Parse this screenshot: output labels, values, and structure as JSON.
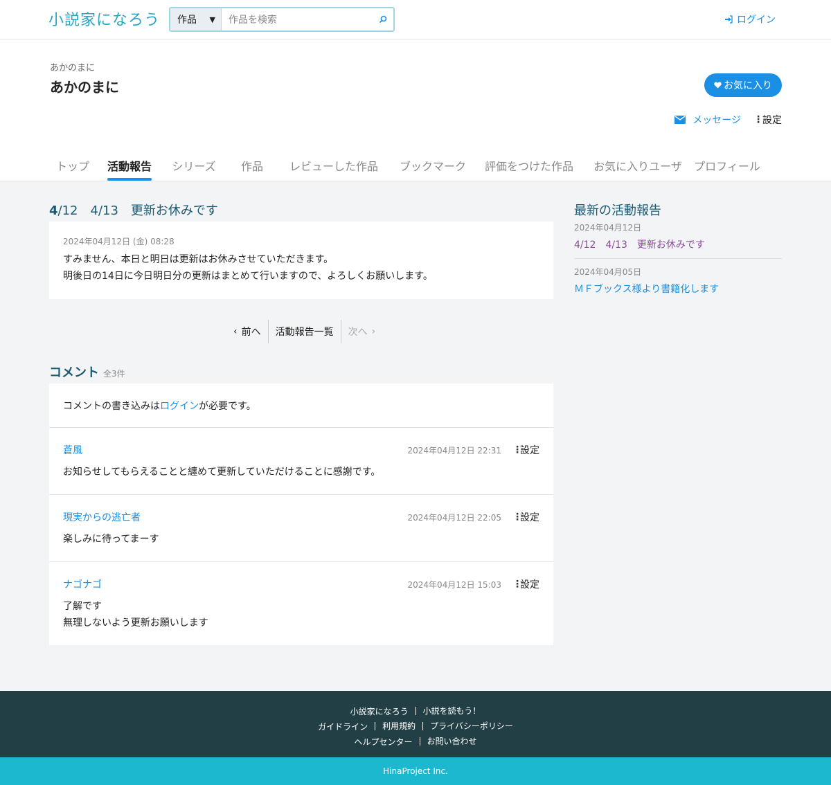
{
  "header": {
    "logo_text": "小説家になろう",
    "search": {
      "category": "作品",
      "placeholder": "作品を検索"
    },
    "login_label": "ログイン"
  },
  "profile": {
    "sub_name": "あかのまに",
    "name": "あかのまに",
    "favorite_label": "お気に入り",
    "message_label": "メッセージ",
    "settings_label": "設定"
  },
  "tabs": [
    "トップ",
    "活動報告",
    "シリーズ",
    "作品",
    "レビューした作品",
    "ブックマーク",
    "評価をつけた作品",
    "お気に入りユーザ",
    "プロフィール"
  ],
  "active_tab": "活動報告",
  "report": {
    "title_bold": "4",
    "title_rest": "/12　4/13　更新お休みです",
    "date": "2024年04月12日 (金) 08:28",
    "lines": [
      "すみません、本日と明日は更新はお休みさせていただきます。",
      "明後日の14日に今日明日分の更新はまとめて行いますので、よろしくお願いします。"
    ]
  },
  "pager": {
    "prev": "前へ",
    "list": "活動報告一覧",
    "next": "次へ"
  },
  "comments": {
    "title": "コメント",
    "count": "全3件",
    "note_before": "コメントの書き込みは",
    "note_link": "ログイン",
    "note_after": "が必要です。",
    "settings_label": "設定",
    "items": [
      {
        "author": "蒼風",
        "date": "2024年04月12日 22:31",
        "lines": [
          "お知らせしてもらえることと纏めて更新していただけることに感謝です。"
        ]
      },
      {
        "author": "現実からの逃亡者",
        "date": "2024年04月12日 22:05",
        "lines": [
          "楽しみに待ってまーす"
        ]
      },
      {
        "author": "ナゴナゴ",
        "date": "2024年04月12日 15:03",
        "lines": [
          "了解です",
          "無理しないよう更新お願いします"
        ]
      }
    ]
  },
  "sidebar": {
    "title": "最新の活動報告",
    "items": [
      {
        "date": "2024年04月12日",
        "title": "4/12　4/13　更新お休みです",
        "visited": true
      },
      {
        "date": "2024年04月05日",
        "title": "ＭＦブックス様より書籍化します",
        "visited": false
      }
    ]
  },
  "footer": {
    "rows": [
      [
        "小説家になろう",
        "小説を読もう！"
      ],
      [
        "ガイドライン",
        "利用規約",
        "プライバシーポリシー"
      ],
      [
        "ヘルプセンター",
        "お問い合わせ"
      ]
    ],
    "copyright": "HinaProject Inc."
  },
  "colors": {
    "accent": "#1a8fe3",
    "heading": "#1c5a72",
    "visited": "#8b4f9a",
    "footer_bg": "#213f45",
    "copyright_bg": "#1bb8cf"
  },
  "icons": {
    "search": "search-icon",
    "login": "login-icon",
    "heart": "heart-icon",
    "mail": "mail-icon",
    "kebab": "kebab-icon"
  }
}
